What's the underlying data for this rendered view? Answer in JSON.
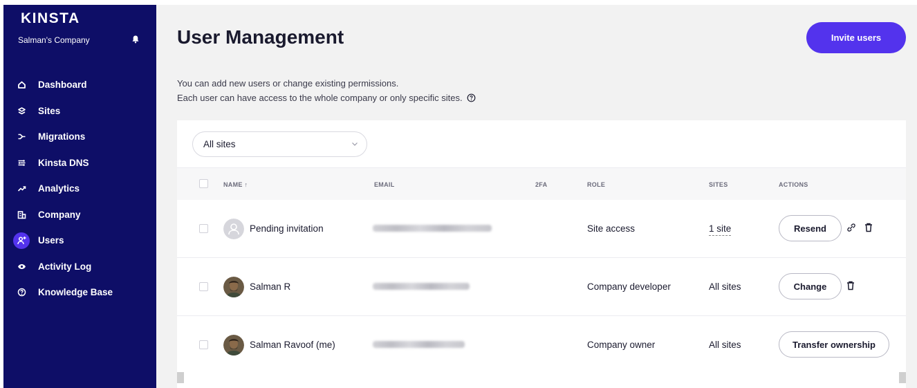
{
  "brand": {
    "logo": "KINSTA",
    "company": "Salman's Company"
  },
  "nav": [
    {
      "label": "Dashboard",
      "icon": "home-icon"
    },
    {
      "label": "Sites",
      "icon": "layers-icon"
    },
    {
      "label": "Migrations",
      "icon": "migrations-icon"
    },
    {
      "label": "Kinsta DNS",
      "icon": "dns-icon"
    },
    {
      "label": "Analytics",
      "icon": "analytics-icon"
    },
    {
      "label": "Company",
      "icon": "company-icon"
    },
    {
      "label": "Users",
      "icon": "users-icon",
      "active": true
    },
    {
      "label": "Activity Log",
      "icon": "eye-icon"
    },
    {
      "label": "Knowledge Base",
      "icon": "help-circle-icon"
    }
  ],
  "header": {
    "title": "User Management",
    "invite_label": "Invite users"
  },
  "description": {
    "line1": "You can add new users or change existing permissions.",
    "line2": "Each user can have access to the whole company or only specific sites."
  },
  "filter": {
    "selected": "All sites"
  },
  "table": {
    "columns": {
      "name": "NAME ↑",
      "email": "EMAIL",
      "twofa": "2FA",
      "role": "ROLE",
      "sites": "SITES",
      "actions": "ACTIONS"
    },
    "rows": [
      {
        "name": "Pending invitation",
        "role": "Site access",
        "sites": "1 site",
        "action": "Resend"
      },
      {
        "name": "Salman R",
        "role": "Company developer",
        "sites": "All sites",
        "action": "Change"
      },
      {
        "name": "Salman Ravoof (me)",
        "role": "Company owner",
        "sites": "All sites",
        "action": "Transfer ownership"
      }
    ]
  },
  "colors": {
    "sidebar": "#0e0e67",
    "accent": "#5333ed",
    "background": "#f2f2f2"
  }
}
